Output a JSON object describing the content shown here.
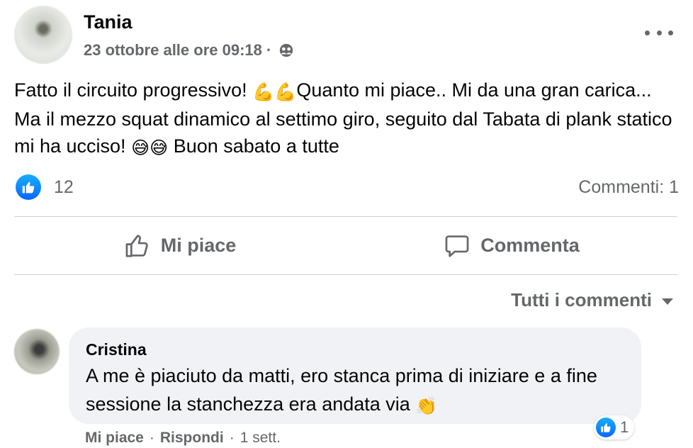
{
  "post": {
    "author": "Tania",
    "date": "23 ottobre alle ore 09:18",
    "separator": "·",
    "audience_icon": "friends-icon",
    "text_part1": "Fatto il circuito progressivo! ",
    "emoji_flex": "💪💪",
    "text_part2": "Quanto mi piace.. Mi da una gran carica... Ma il mezzo squat dinamico al settimo giro, seguito dal Tabata di plank statico mi ha ucciso! ",
    "emoji_sweat": "😅😅",
    "text_part3": " Buon sabato a tutte"
  },
  "reactions": {
    "like_count": "12",
    "comments_label": "Commenti: 1"
  },
  "actions": {
    "like_label": "Mi piace",
    "comment_label": "Commenta"
  },
  "comments_filter": {
    "label": "Tutti i commenti"
  },
  "comment": {
    "author": "Cristina",
    "text": "A me è piaciuto da matti, ero stanca prima di iniziare e a fine sessione la stanchezza era andata via ",
    "emoji": "👏",
    "reaction_count": "1",
    "like_label": "Mi piace",
    "reply_label": "Rispondi",
    "separator": "·",
    "time": "1 sett."
  },
  "colors": {
    "accent": "#0866ff",
    "secondary_text": "#65676b",
    "bubble": "#f0f2f5"
  }
}
